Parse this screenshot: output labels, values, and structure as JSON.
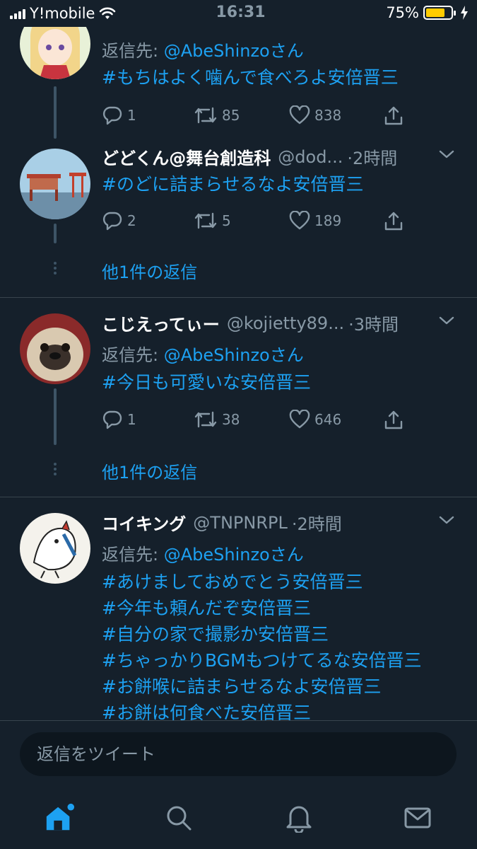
{
  "status_bar": {
    "carrier": "Y!mobile",
    "time": "16:31",
    "battery_percent": "75%",
    "battery_level": 0.75,
    "icons": [
      "signal-icon",
      "wifi-icon",
      "battery-icon",
      "charging-icon"
    ]
  },
  "tweets": [
    {
      "reply_prefix": "返信先: ",
      "reply_mention": "@AbeShinzoさん",
      "body": [
        "#もちはよく噛んで食べろよ安倍晋三"
      ],
      "replies": "1",
      "retweets": "85",
      "likes": "838"
    },
    {
      "name": "どどくん@舞台創造科",
      "handle": "@dod...",
      "time": "·2時間",
      "body": [
        "#のどに詰まらせるなよ安倍晋三"
      ],
      "replies": "2",
      "retweets": "5",
      "likes": "189",
      "more_replies": "他1件の返信"
    },
    {
      "name": "こじえってぃー",
      "handle": "@kojietty89...",
      "time": "·3時間",
      "reply_prefix": "返信先: ",
      "reply_mention": "@AbeShinzoさん",
      "body": [
        "#今日も可愛いな安倍晋三"
      ],
      "replies": "1",
      "retweets": "38",
      "likes": "646",
      "more_replies": "他1件の返信"
    },
    {
      "name": "コイキング",
      "handle": "@TNPNRPL",
      "time": "·2時間",
      "reply_prefix": "返信先: ",
      "reply_mention": "@AbeShinzoさん",
      "body": [
        "#あけましておめでとう安倍晋三",
        "#今年も頼んだぞ安倍晋三",
        "#自分の家で撮影か安倍晋三",
        "#ちゃっかりBGMもつけてるな安倍晋三",
        "#お餅喉に詰まらせるなよ安倍晋三",
        "#お餅は何食べた安倍晋三"
      ]
    }
  ],
  "reply_bar": {
    "placeholder": "返信をツイート"
  },
  "tab_bar": {
    "icons": [
      "home-icon",
      "search-icon",
      "notifications-icon",
      "messages-icon"
    ]
  },
  "colors": {
    "background": "#15202b",
    "accent": "#1da1f2",
    "muted": "#8899a6",
    "divider": "#38444d"
  }
}
